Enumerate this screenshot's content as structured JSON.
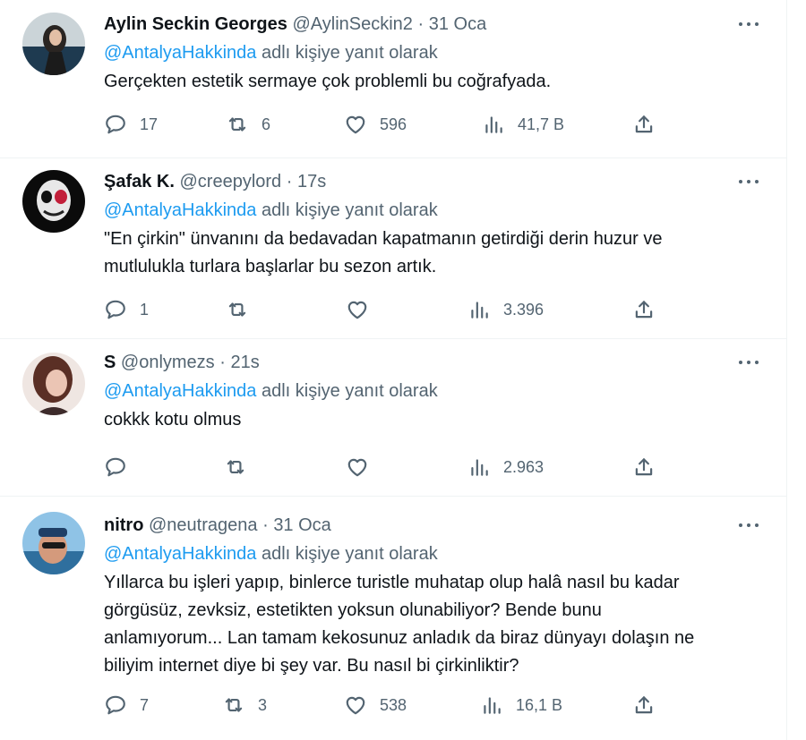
{
  "tweets": [
    {
      "name": "Aylin Seckin Georges",
      "handle": "@AylinSeckin2",
      "dot": "·",
      "time": "31 Oca",
      "reply_mention": "@AntalyaHakkinda",
      "reply_suffix": " adlı kişiye yanıt olarak",
      "lines": [
        "Gerçekten estetik sermaye çok problemli bu coğrafyada."
      ],
      "replies": "17",
      "retweets": "6",
      "likes": "596",
      "views": "41,7 B",
      "avatar_colors": [
        "#1e3b52",
        "#c9d2d6"
      ]
    },
    {
      "name": "Şafak K.",
      "handle": "@creepylord",
      "dot": "·",
      "time": "17s",
      "reply_mention": "@AntalyaHakkinda",
      "reply_suffix": " adlı kişiye yanıt olarak",
      "lines": [
        "\"En çirkin\" ünvanını da bedavadan kapatmanın getirdiği derin huzur ve",
        "mutlulukla turlara başlarlar bu sezon artık."
      ],
      "replies": "1",
      "retweets": "",
      "likes": "",
      "views": "3.396",
      "avatar_colors": [
        "#0b0b0b",
        "#e6e6e6"
      ]
    },
    {
      "name": "S",
      "handle": "@onlymezs",
      "dot": "·",
      "time": "21s",
      "reply_mention": "@AntalyaHakkinda",
      "reply_suffix": " adlı kişiye yanıt olarak",
      "lines": [
        "cokkk kotu olmus"
      ],
      "replies": "",
      "retweets": "",
      "likes": "",
      "views": "2.963",
      "avatar_colors": [
        "#6b3a2e",
        "#e9c7b8"
      ]
    },
    {
      "name": "nitro",
      "handle": "@neutragena",
      "dot": "·",
      "time": "31 Oca",
      "reply_mention": "@AntalyaHakkinda",
      "reply_suffix": " adlı kişiye yanıt olarak",
      "lines": [
        "Yıllarca bu işleri yapıp, binlerce turistle muhatap olup halâ nasıl bu kadar",
        "görgüsüz, zevksiz, estetikten yoksun olunabiliyor? Bende bunu",
        "anlamıyorum... Lan tamam kekosunuz anladık da biraz dünyayı dolaşın ne",
        "biliyim internet diye bi şey var. Bu nasıl bi çirkinliktir?"
      ],
      "replies": "7",
      "retweets": "3",
      "likes": "538",
      "views": "16,1 B",
      "avatar_colors": [
        "#3f7fb5",
        "#d9a58b"
      ]
    }
  ],
  "icons": {
    "reply": "reply-icon",
    "retweet": "retweet-icon",
    "like": "heart-icon",
    "views": "views-icon",
    "share": "share-icon",
    "more": "more-icon"
  },
  "colors": {
    "text": "#0f1419",
    "secondary": "#536471",
    "link": "#1d9bf0",
    "divider": "#eff3f4"
  }
}
